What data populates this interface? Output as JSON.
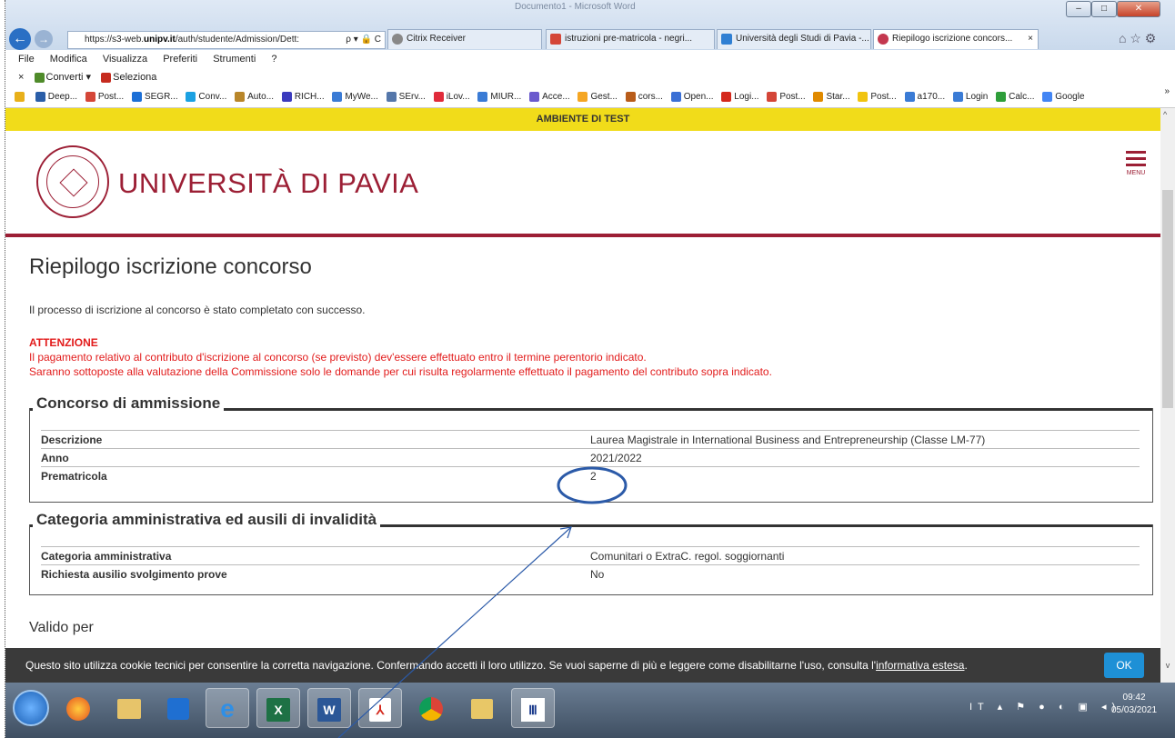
{
  "window": {
    "title": "Documento1 - Microsoft Word",
    "minimize": "–",
    "maximize": "□",
    "close": "✕"
  },
  "browser": {
    "url_prefix": "https://s3-web.",
    "url_domain": "unipv.it",
    "url_rest": "/auth/studente/Admission/Dett:",
    "addr_controls": "ρ ▾ 🔒 C",
    "back": "←",
    "forward": "→",
    "tabs": [
      {
        "label": "Citrix Receiver",
        "icon_color": "#888888"
      },
      {
        "label": "istruzioni pre-matricola - negri...",
        "icon_color": "#d44638"
      },
      {
        "label": "Università degli Studi di Pavia -...",
        "icon_color": "#2f7fd3"
      },
      {
        "label": "Riepilogo iscrizione concors...",
        "icon_color": "#c4384f"
      }
    ],
    "tab_close": "×",
    "right_icons": "⌂ ☆ ⚙",
    "menu": [
      "File",
      "Modifica",
      "Visualizza",
      "Preferiti",
      "Strumenti",
      "?"
    ],
    "toolbar": {
      "close": "×",
      "converti": "Converti",
      "seleziona": "Seleziona"
    },
    "favorites": [
      "Deep...",
      "Post...",
      "SEGR...",
      "Conv...",
      "Auto...",
      "RICH...",
      "MyWe...",
      "SErv...",
      "iLov...",
      "MIUR...",
      "Acce...",
      "Gest...",
      "cors...",
      "Open...",
      "Logi...",
      "Post...",
      "Star...",
      "Post...",
      "a170...",
      "Login",
      "Calc...",
      "Google"
    ],
    "favorites_more": "»"
  },
  "test_banner": "AMBIENTE DI TEST",
  "header": {
    "university": "UNIVERSITÀ DI PAVIA",
    "menu_label": "MENU"
  },
  "page": {
    "title": "Riepilogo iscrizione concorso",
    "success": "Il processo di iscrizione al concorso è stato completato con successo.",
    "attention_title": "ATTENZIONE",
    "attention_lines": [
      "Il pagamento relativo al contributo d'iscrizione al concorso (se previsto) dev'essere effettuato entro il termine perentorio indicato.",
      "Saranno sottoposte alla valutazione della Commissione solo le domande per cui risulta regolarmente effettuato il pagamento del contributo sopra indicato."
    ],
    "section1": {
      "title": "Concorso di ammissione",
      "rows": [
        {
          "key": "Descrizione",
          "value": "Laurea Magistrale in International Business and Entrepreneurship (Classe LM-77)"
        },
        {
          "key": "Anno",
          "value": "2021/2022"
        },
        {
          "key": "Prematricola",
          "value": "2"
        }
      ]
    },
    "section2": {
      "title": "Categoria amministrativa ed ausili di invalidità",
      "rows": [
        {
          "key": "Categoria amministrativa",
          "value": "Comunitari o ExtraC. regol. soggiornanti"
        },
        {
          "key": "Richiesta ausilio svolgimento prove",
          "value": "No"
        }
      ]
    },
    "valido_per": "Valido per"
  },
  "cookie": {
    "text": "Questo sito utilizza cookie tecnici per consentire la corretta navigazione. Confermando accetti il loro utilizzo. Se vuoi saperne di più e leggere come disabilitarne l'uso, consulta l'",
    "link": "informativa estesa",
    "end": ".",
    "ok": "OK"
  },
  "taskbar": {
    "apps": [
      "firefox-icon",
      "explorer-icon",
      "outlook-icon",
      "ie-icon",
      "excel-icon",
      "word-icon",
      "acrobat-icon",
      "chrome-icon",
      "files-icon",
      "museum-icon"
    ],
    "app_glyphs": [
      "",
      "",
      "",
      "e",
      "X",
      "W",
      "⅄",
      "",
      "",
      "Ⅲ"
    ],
    "lang": "IT",
    "time": "09:42",
    "date": "05/03/2021"
  },
  "colors": {
    "brand": "#9c1f35",
    "warning": "#e21b1b",
    "test_banner": "#f1dc1a",
    "ok_button": "#1e90d6",
    "annotation": "#2b5aa8"
  }
}
